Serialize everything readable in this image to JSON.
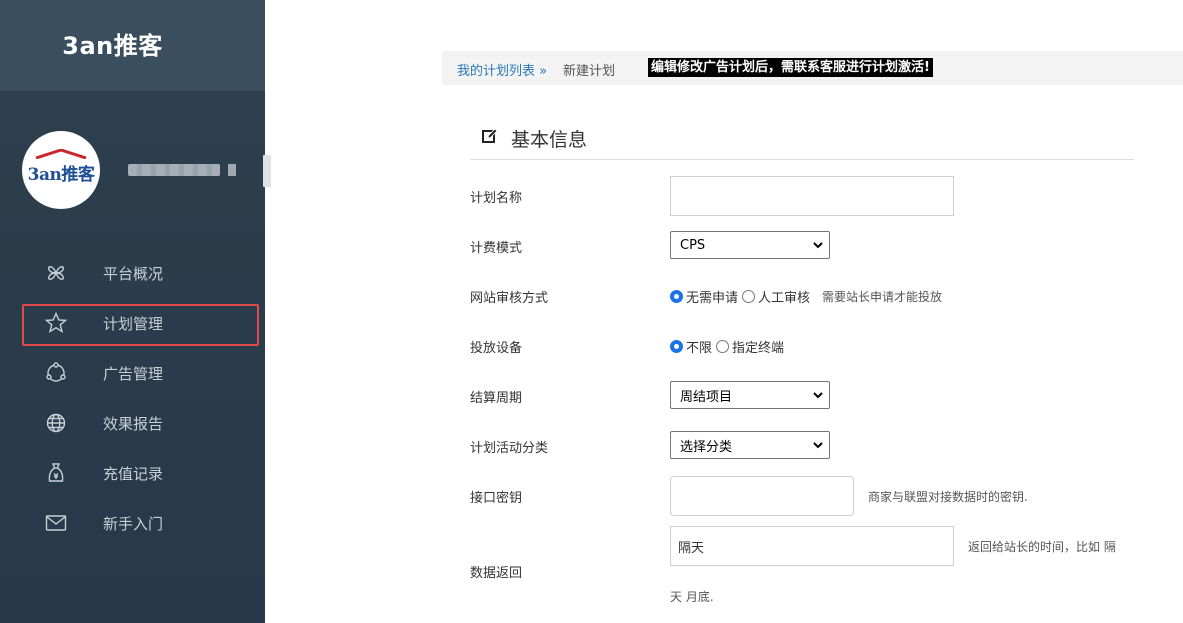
{
  "sidebar": {
    "brand": "3an推客",
    "avatar_text": "3an推客",
    "nav": [
      {
        "label": "平台概况",
        "icon": "cluster-icon"
      },
      {
        "label": "计划管理",
        "icon": "star-icon",
        "active": true
      },
      {
        "label": "广告管理",
        "icon": "share-circle-icon"
      },
      {
        "label": "效果报告",
        "icon": "globe-icon"
      },
      {
        "label": "充值记录",
        "icon": "money-bag-icon"
      },
      {
        "label": "新手入门",
        "icon": "envelope-icon"
      }
    ]
  },
  "breadcrumb": {
    "link": "我的计划列表 »",
    "current": "新建计划"
  },
  "notice": "编辑修改广告计划后，需联系客服进行计划激活!",
  "section": {
    "title": "基本信息",
    "icon": "edit-icon"
  },
  "form": {
    "plan_name": {
      "label": "计划名称",
      "value": ""
    },
    "billing_mode": {
      "label": "计费模式",
      "selected": "CPS"
    },
    "review_method": {
      "label": "网站审核方式",
      "options": [
        "无需申请",
        "人工审核"
      ],
      "selected": "无需申请",
      "hint": "需要站长申请才能投放"
    },
    "device": {
      "label": "投放设备",
      "options": [
        "不限",
        "指定终端"
      ],
      "selected": "不限"
    },
    "settlement": {
      "label": "结算周期",
      "selected": "周结项目"
    },
    "category": {
      "label": "计划活动分类",
      "selected": "选择分类"
    },
    "api_key": {
      "label": "接口密钥",
      "value": "",
      "hint": "商家与联盟对接数据时的密钥."
    },
    "data_return": {
      "label": "数据返回",
      "value": "隔天",
      "hint_line1": "返回给站长的时间，比如 隔",
      "hint_line2": "天 月底."
    }
  },
  "colors": {
    "sidebar_bg": "#2b3d4b",
    "brand_bg": "#3a4e5e",
    "active_outline": "#e24a4a",
    "link": "#2a7ab8",
    "radio_checked": "#1a73e8"
  }
}
